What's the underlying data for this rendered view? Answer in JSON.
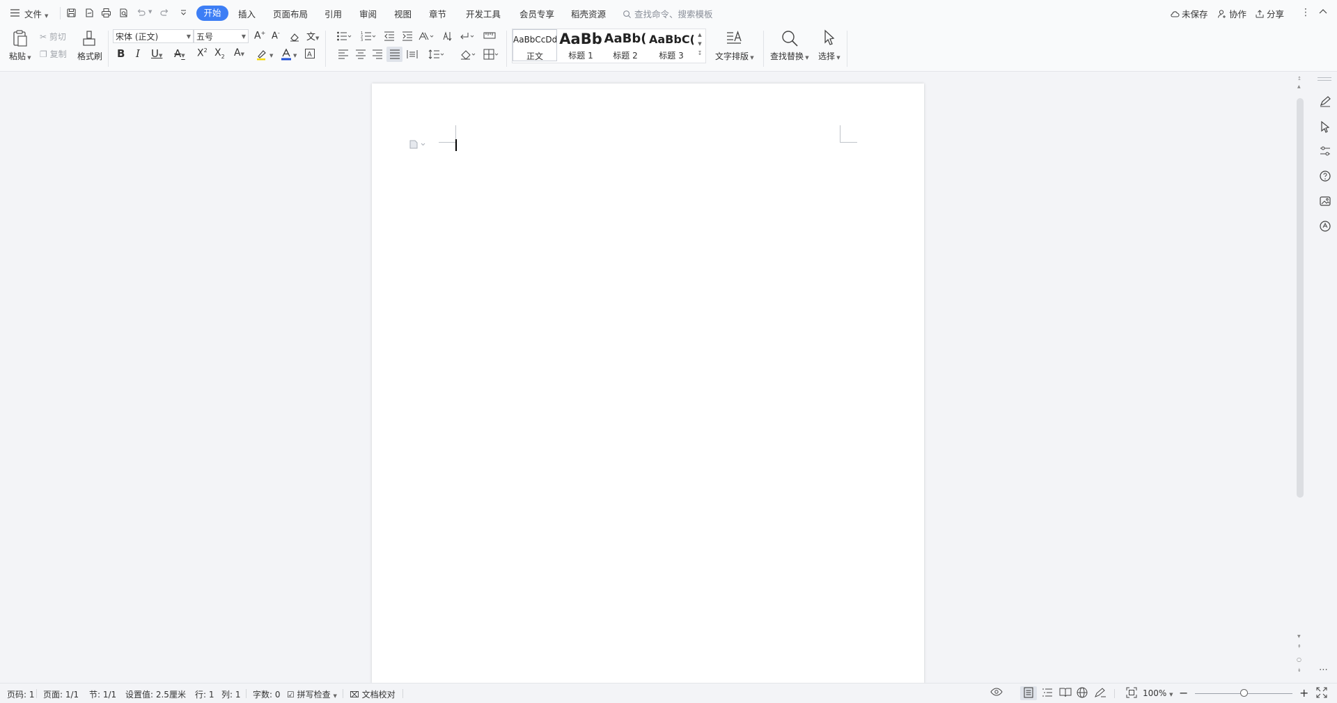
{
  "menu": {
    "file_label": "文件",
    "tabs": [
      "开始",
      "插入",
      "页面布局",
      "引用",
      "审阅",
      "视图",
      "章节",
      "开发工具",
      "会员专享",
      "稻壳资源"
    ],
    "search_placeholder": "查找命令、搜索模板",
    "unsaved_label": "未保存",
    "collab_label": "协作",
    "share_label": "分享"
  },
  "ribbon": {
    "paste_label": "粘贴",
    "cut_label": "剪切",
    "copy_label": "复制",
    "format_painter_label": "格式刷",
    "font_name": "宋体 (正文)",
    "font_size": "五号",
    "styles": [
      {
        "sample": "AaBbCcDd",
        "name": "正文"
      },
      {
        "sample": "AaBb",
        "name": "标题 1"
      },
      {
        "sample": "AaBb(",
        "name": "标题 2"
      },
      {
        "sample": "AaBbC(",
        "name": "标题 3"
      }
    ],
    "text_layout_label": "文字排版",
    "find_replace_label": "查找替换",
    "select_label": "选择"
  },
  "status": {
    "page_num": "页码: 1",
    "pages": "页面: 1/1",
    "section": "节: 1/1",
    "setting": "设置值: 2.5厘米",
    "row": "行: 1",
    "col": "列: 1",
    "word_count": "字数: 0",
    "spell_check": "拼写检查",
    "doc_proof": "文档校对",
    "zoom": "100%",
    "zoom_level": 0.5
  },
  "colors": {
    "accent": "#3d7ef5",
    "font_color_bar": "#1f4fd6",
    "highlight_bar": "#f5d90a"
  }
}
